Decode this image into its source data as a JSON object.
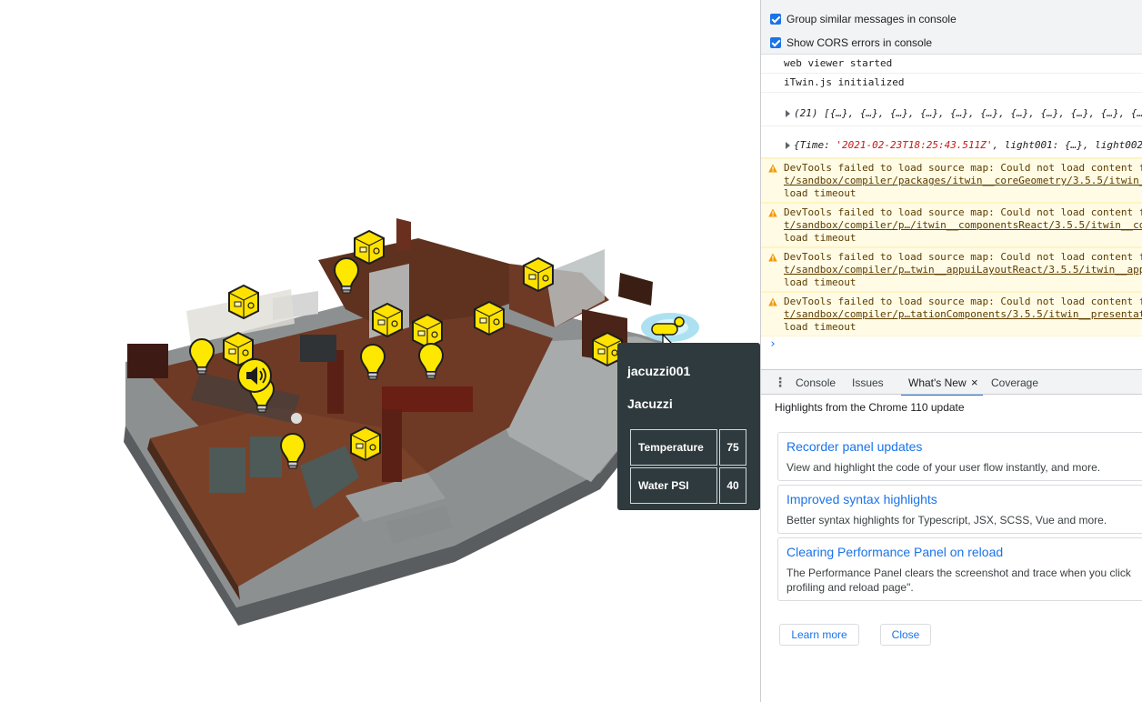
{
  "tooltip": {
    "element_id": "jacuzzi001",
    "element_name": "Jacuzzi",
    "properties": [
      {
        "name": "Temperature",
        "value": "75"
      },
      {
        "name": "Water PSI",
        "value": "40"
      }
    ]
  },
  "devtools": {
    "settings": [
      {
        "label": "Group similar messages in console",
        "checked": true
      },
      {
        "label": "Show CORS errors in console",
        "checked": true
      }
    ],
    "messages": {
      "log1": "web viewer started",
      "log2": "iTwin.js initialized",
      "array": "(21) [{…}, {…}, {…}, {…}, {…}, {…}, {…}, {…}, {…}, {…}, {…",
      "object_prefix": "{Time: ",
      "object_time": "'2021-02-23T18:25:43.511Z'",
      "object_suffix": ", light001: {…}, light002"
    },
    "warnings": [
      {
        "line1": "DevTools failed to load source map: Could not load content f",
        "link": "t/sandbox/compiler/packages/itwin__coreGeometry/3.5.5/itwin_",
        "line3": "load timeout"
      },
      {
        "line1": "DevTools failed to load source map: Could not load content f",
        "link": "t/sandbox/compiler/p…/itwin__componentsReact/3.5.5/itwin__co",
        "line3": "load timeout"
      },
      {
        "line1": "DevTools failed to load source map: Could not load content f",
        "link": "t/sandbox/compiler/p…twin__appuiLayoutReact/3.5.5/itwin__app",
        "line3": "load timeout"
      },
      {
        "line1": "DevTools failed to load source map: Could not load content f",
        "link": "t/sandbox/compiler/p…tationComponents/3.5.5/itwin__presentat",
        "line3": "load timeout"
      }
    ],
    "prompt": "›",
    "drawer": {
      "kebab": "⋮",
      "tabs": [
        "Console",
        "Issues",
        "What's New",
        "Coverage"
      ],
      "close": "×"
    },
    "whats_new": {
      "highlights": "Highlights from the Chrome 110 update",
      "cards": [
        {
          "title": "Recorder panel updates",
          "desc": "View and highlight the code of your user flow instantly, and more."
        },
        {
          "title": "Improved syntax highlights",
          "desc": "Better syntax highlights for Typescript, JSX, SCSS, Vue and more."
        },
        {
          "title": "Clearing Performance Panel on reload",
          "desc": "The Performance Panel clears the screenshot and trace when you click profiling and reload page\"."
        }
      ],
      "learn_more": "Learn more",
      "close_button": "Close"
    }
  },
  "colors": {
    "accent": "#1a73e8",
    "tooltip_bg": "#2f3a3e",
    "warning_bg": "#fffbe5",
    "marker_yellow": "#ffe800",
    "floor_wood": "#6e3a25",
    "walls_gray": "#8d9091"
  },
  "icons": [
    "lightbulb-icon",
    "speaker-icon",
    "appliance-icon",
    "jacuzzi-icon",
    "mouse-cursor-icon",
    "warning-icon",
    "checkbox-icon",
    "expand-arrow-icon",
    "close-icon",
    "kebab-menu-icon"
  ]
}
